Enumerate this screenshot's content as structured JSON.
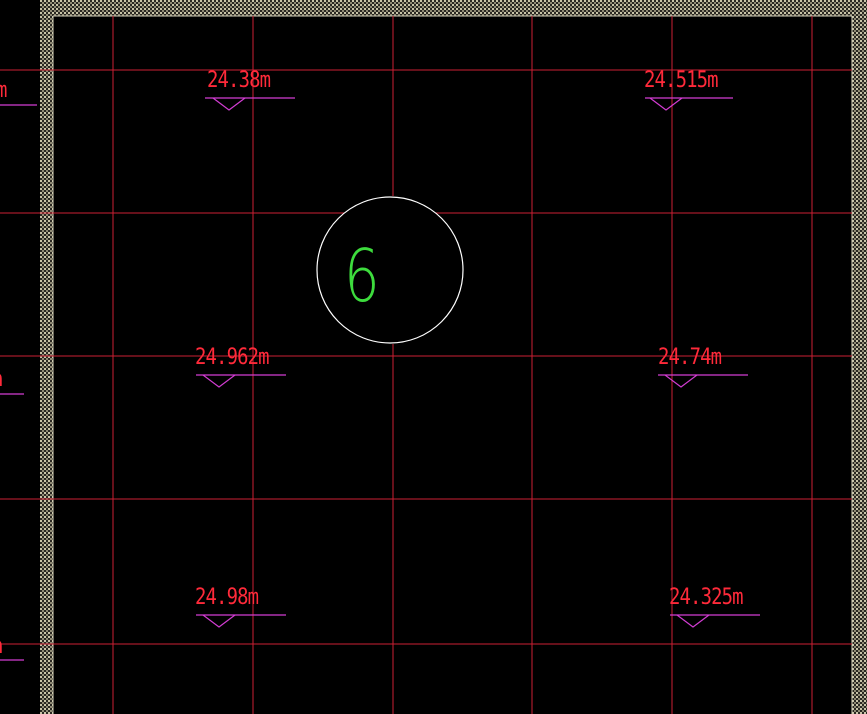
{
  "drawing": {
    "grid_bubble": {
      "label": "6"
    },
    "elevations": [
      {
        "id": "el-1",
        "text": "24.38m"
      },
      {
        "id": "el-2",
        "text": "24.515m"
      },
      {
        "id": "el-3",
        "text": "24.962m"
      },
      {
        "id": "el-4",
        "text": "24.74m"
      },
      {
        "id": "el-5",
        "text": "24.98m"
      },
      {
        "id": "el-6",
        "text": "24.325m"
      }
    ],
    "edge_fragments": [
      "m",
      "n",
      "n"
    ],
    "colors": {
      "background": "#000000",
      "grid_lines": "#cc1f33",
      "elevation_text": "#ff2a3a",
      "elevation_marker": "#d23cd2",
      "bubble_circle": "#ffffff",
      "bubble_text": "#3ddc3d",
      "wall_hatch": "#b9b49a"
    }
  }
}
